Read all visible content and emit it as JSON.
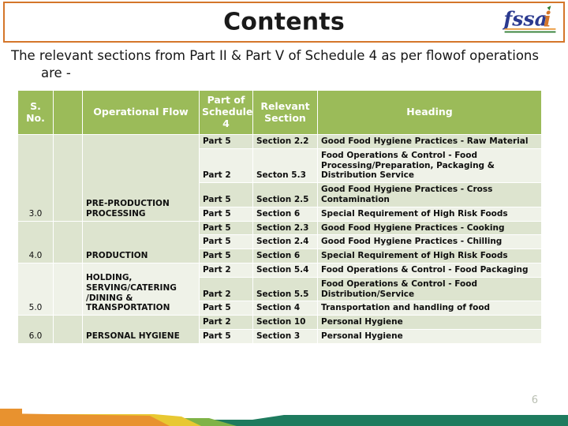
{
  "slide": {
    "title": "Contents",
    "logo_text": "fssai",
    "page_number": "6",
    "subtitle_line1": "The relevant sections from Part II & Part V of Schedule 4 as per flowof operations",
    "subtitle_line2": "are -"
  },
  "colors": {
    "title_border": "#D4762A",
    "header_green": "#9BBB59",
    "row_dark": "#DDE4CF",
    "row_light": "#EFF2E8",
    "bar_orange": "#E8922F",
    "bar_yellow": "#E8C832",
    "bar_green": "#7FB347",
    "bar_teal": "#1E7B5E"
  },
  "table": {
    "headers": {
      "sno": "S. No.",
      "gap": "",
      "flow": "Operational Flow",
      "part": "Part of Schedule 4",
      "section": "Relevant Section",
      "heading": "Heading"
    },
    "groups": [
      {
        "sno": "3.0",
        "flow": "PRE-PRODUCTION PROCESSING",
        "rows": [
          {
            "part": "Part 5",
            "section": "Section 2.2",
            "heading": "Good Food Hygiene Practices - Raw Material",
            "shade": "dark",
            "align": "bottom"
          },
          {
            "part": "Part 2",
            "section": "Secton 5.3",
            "heading": "Food Operations & Control - Food Processing/Preparation, Packaging & Distribution Service",
            "shade": "light",
            "align": "top"
          },
          {
            "part": "Part 5",
            "section": "Section 2.5",
            "heading": "Good Food Hygiene Practices - Cross Contamination",
            "shade": "dark",
            "align": "top"
          },
          {
            "part": "Part 5",
            "section": "Section 6",
            "heading": "Special Requirement of High Risk Foods",
            "shade": "light",
            "align": "bottom"
          }
        ]
      },
      {
        "sno": "4.0",
        "flow": "PRODUCTION",
        "rows": [
          {
            "part": "Part 5",
            "section": "Section 2.3",
            "heading": "Good Food Hygiene Practices - Cooking",
            "shade": "dark",
            "align": "bottom"
          },
          {
            "part": "Part 5",
            "section": "Section 2.4",
            "heading": "Good Food Hygiene Practices - Chilling",
            "shade": "light",
            "align": "bottom"
          },
          {
            "part": "Part 5",
            "section": "Section 6",
            "heading": "Special Requirement of High Risk Foods",
            "shade": "dark",
            "align": "bottom"
          }
        ]
      },
      {
        "sno": "5.0",
        "flow": "HOLDING, SERVING/CATERING /DINING & TRANSPORTATION",
        "rows": [
          {
            "part": "Part 2",
            "section": "Section 5.4",
            "heading": "Food Operations & Control - Food Packaging",
            "shade": "light",
            "align": "bottom"
          },
          {
            "part": "Part 2",
            "section": "Section 5.5",
            "heading": "Food Operations & Control - Food Distribution/Service",
            "shade": "dark",
            "align": "top"
          },
          {
            "part": "Part 5",
            "section": "Section 4",
            "heading": "Transportation and handling of food",
            "shade": "light",
            "align": "bottom"
          }
        ]
      },
      {
        "sno": "6.0",
        "flow": "PERSONAL HYGIENE",
        "rows": [
          {
            "part": "Part 2",
            "section": "Section 10",
            "heading": "Personal Hygiene",
            "shade": "dark",
            "align": "bottom"
          },
          {
            "part": "Part 5",
            "section": "Section 3",
            "heading": "Personal Hygiene",
            "shade": "light",
            "align": "bottom"
          }
        ]
      }
    ]
  }
}
